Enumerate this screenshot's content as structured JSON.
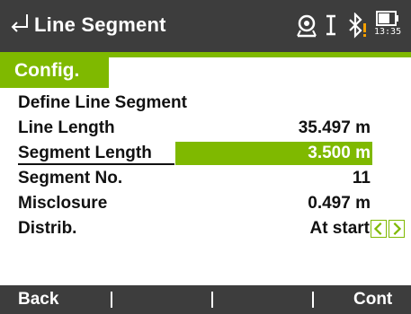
{
  "titlebar": {
    "title": "Line Segment",
    "time": "13:35",
    "icons": [
      "back-arrow-icon",
      "target-prism-icon",
      "cursor-i-icon",
      "bluetooth-warning-icon",
      "battery-icon"
    ]
  },
  "tab": {
    "label": "Config."
  },
  "form": {
    "section_header": "Define Line Segment",
    "rows": [
      {
        "label": "Line Length",
        "value": "35.497 m"
      },
      {
        "label": "Segment Length",
        "value": "3.500 m"
      },
      {
        "label": "Segment No.",
        "value": "11"
      },
      {
        "label": "Misclosure",
        "value": "0.497 m"
      },
      {
        "label": "Distrib.",
        "value": "At start"
      }
    ]
  },
  "fkeys": {
    "f1": "Back",
    "f2": "",
    "f3": "",
    "f4": "Cont"
  },
  "colors": {
    "accent": "#7fb900",
    "bar": "#3d3d3d",
    "warning": "#f5a000"
  }
}
